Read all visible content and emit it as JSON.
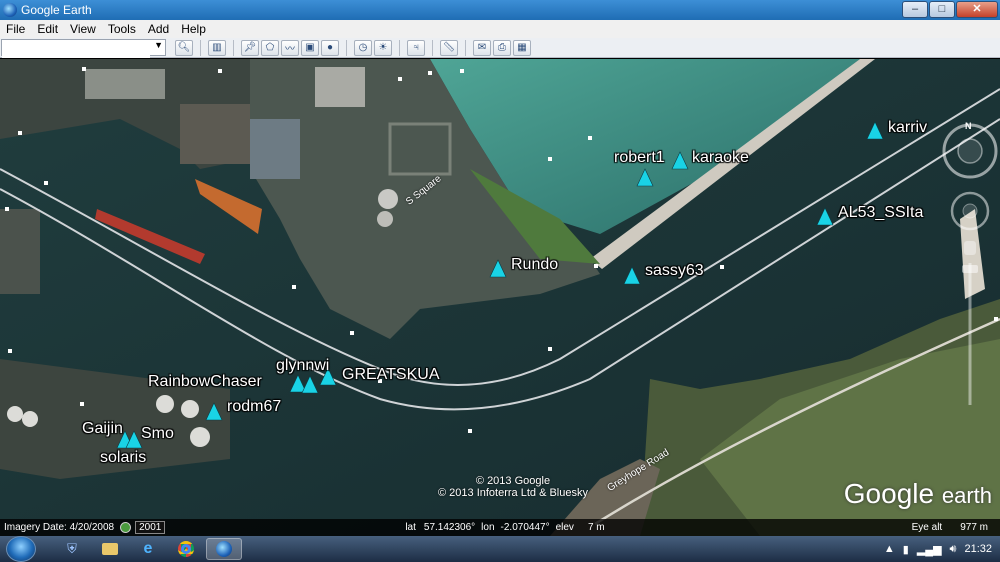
{
  "window": {
    "title": "Google Earth",
    "minimize": "–",
    "maximize": "□",
    "close": "✕"
  },
  "menu": [
    "File",
    "Edit",
    "View",
    "Tools",
    "Add",
    "Help"
  ],
  "search": {
    "value": "",
    "placeholder": ""
  },
  "toolbar_icons": [
    "search-icon",
    "sidebar-icon",
    "placemark-icon",
    "polygon-icon",
    "path-icon",
    "image-overlay-icon",
    "record-tour-icon",
    "historical-imagery-icon",
    "sunlight-icon",
    "planets-icon",
    "ruler-icon",
    "email-icon",
    "print-icon",
    "view-in-maps-icon"
  ],
  "boats": [
    {
      "name": "robert1"
    },
    {
      "name": "karaoke"
    },
    {
      "name": "karriv"
    },
    {
      "name": "AL53_SSIta"
    },
    {
      "name": "Rundo"
    },
    {
      "name": "sassy63"
    },
    {
      "name": "glynnwi"
    },
    {
      "name": "GREATSKUA"
    },
    {
      "name": "RainbowChaser"
    },
    {
      "name": "rodm67"
    },
    {
      "name": "Gaijin"
    },
    {
      "name": "Smo"
    },
    {
      "name": "solaris"
    }
  ],
  "streets": {
    "square": "S Square",
    "greyhope": "Greyhope Road"
  },
  "copyright": [
    "© 2013 Google",
    "© 2013 Infoterra Ltd & Bluesky"
  ],
  "logo": {
    "google": "Google",
    "earth": "earth"
  },
  "compass_north": "N",
  "status": {
    "imagery_date": "Imagery Date: 4/20/2008",
    "year": "2001",
    "lat_label": "lat",
    "lat": "57.142306°",
    "lon_label": "lon",
    "lon": "-2.070447°",
    "elev_label": "elev",
    "elev": "7 m",
    "eye_label": "Eye alt",
    "eye": "977 m"
  },
  "clock": "21:32",
  "colors": {
    "water": "#1e3a3a",
    "sea": "#2f7d74",
    "land": "#3a4a3c",
    "boat": "#19d3e6",
    "path": "#cfd3d6"
  }
}
